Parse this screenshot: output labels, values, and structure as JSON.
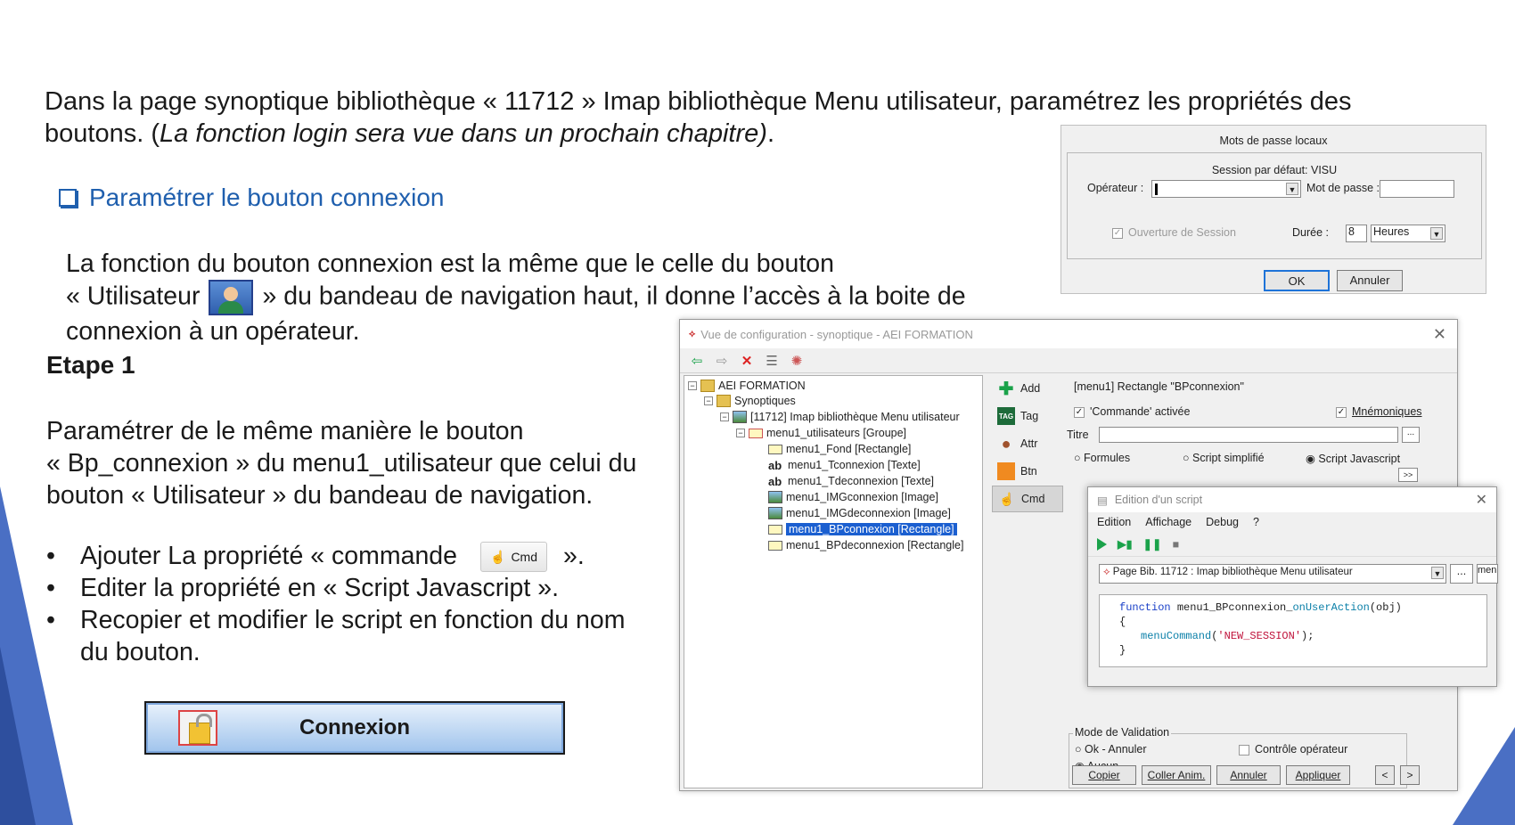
{
  "intro": {
    "line1": "Dans la page synoptique bibliothèque  « 11712 » Imap bibliothèque Menu utilisateur, paramétrez les propriétés des",
    "line2_prefix": "boutons. (",
    "line2_italic": "La fonction login sera  vue dans un prochain chapitre)",
    "line2_suffix": "."
  },
  "section": {
    "heading": "Paramétrer le bouton connexion"
  },
  "para1": {
    "line1": "La fonction du bouton connexion est la même que le celle du bouton",
    "line2_prefix": "« Utilisateur",
    "line2_suffix": "» du bandeau de navigation haut, il donne l’accès à la boite de",
    "line3": "connexion à un opérateur."
  },
  "etape": "Etape 1",
  "para2": {
    "line1": "Paramétrer de le même manière le bouton",
    "line2": "« Bp_connexion » du menu1_utilisateur que celui du",
    "line3": "bouton « Utilisateur » du bandeau de navigation."
  },
  "bullets": {
    "b1_prefix": "Ajouter La propriété « commande",
    "b1_chip": "Cmd",
    "b1_suffix": "».",
    "b2": "Editer la propriété en « Script Javascript ».",
    "b3_line1": "Recopier et modifier le script en fonction du nom",
    "b3_line2": "du bouton."
  },
  "connexion_button": {
    "label": "Connexion"
  },
  "password_dialog": {
    "title": "Mots de passe locaux",
    "session": "Session par défaut: VISU",
    "operator_label": "Opérateur :",
    "password_label": "Mot de passe :",
    "open_session": "Ouverture de Session",
    "duration_label": "Durée :",
    "duration_value": "8",
    "duration_unit": "Heures",
    "ok": "OK",
    "cancel": "Annuler"
  },
  "config_window": {
    "title": "Vue de configuration - synoptique - AEI FORMATION",
    "tree": [
      {
        "label": "AEI FORMATION",
        "icon": "project"
      },
      {
        "label": "Synoptiques",
        "icon": "folder"
      },
      {
        "label": "[11712]  Imap bibliothèque Menu utilisateur",
        "icon": "page"
      },
      {
        "label": "menu1_utilisateurs [Groupe]",
        "icon": "group"
      },
      {
        "label": "menu1_Fond [Rectangle]",
        "icon": "rect"
      },
      {
        "label": "menu1_Tconnexion [Texte]",
        "icon": "text"
      },
      {
        "label": "menu1_Tdeconnexion [Texte]",
        "icon": "text"
      },
      {
        "label": "menu1_IMGconnexion [Image]",
        "icon": "image"
      },
      {
        "label": "menu1_IMGdeconnexion [Image]",
        "icon": "image"
      },
      {
        "label": "menu1_BPconnexion [Rectangle]",
        "icon": "rect"
      },
      {
        "label": "menu1_BPdeconnexion [Rectangle]",
        "icon": "rect"
      }
    ],
    "side_tabs": {
      "add": "Add",
      "tag": "Tag",
      "tag_icon": "TAG",
      "attr": "Attr",
      "btn": "Btn",
      "cmd": "Cmd"
    },
    "object_title": "[menu1] Rectangle  \"BPconnexion\"",
    "cmd_active": "'Commande' activée",
    "mnemoniques": "Mnémoniques",
    "titre_label": "Titre",
    "formules": "Formules",
    "script_simplifie": "Script simplifié",
    "script_javascript": "Script Javascript",
    "expand_btn": ">>",
    "mode_validation": "Mode de Validation",
    "ok_annuler": "Ok - Annuler",
    "aucun": "Aucun",
    "controle_operateur": "Contrôle opérateur",
    "buttons": {
      "copier": "Copier",
      "coller": "Coller Anim.",
      "annuler": "Annuler",
      "appliquer": "Appliquer",
      "prev": "<",
      "next": ">"
    }
  },
  "script_window": {
    "title": "Edition d'un script",
    "menus": [
      "Edition",
      "Affichage",
      "Debug",
      "?"
    ],
    "page_combo": "Page Bib. 11712 : Imap bibliothèque Menu utilisateur",
    "browse": "...",
    "side_field": "men",
    "code": {
      "kw": "function",
      "name": "menu1_BPconnexion_",
      "event": "onUserAction",
      "args": "(obj)",
      "brace_open": "{",
      "call": "menuCommand",
      "arg_str": "'NEW_SESSION'",
      "call_end": ");",
      "brace_close": "}"
    }
  },
  "colors": {
    "accent_blue": "#1f5fae",
    "selection": "#1b5fd0",
    "deco": "#4a6fc4"
  }
}
